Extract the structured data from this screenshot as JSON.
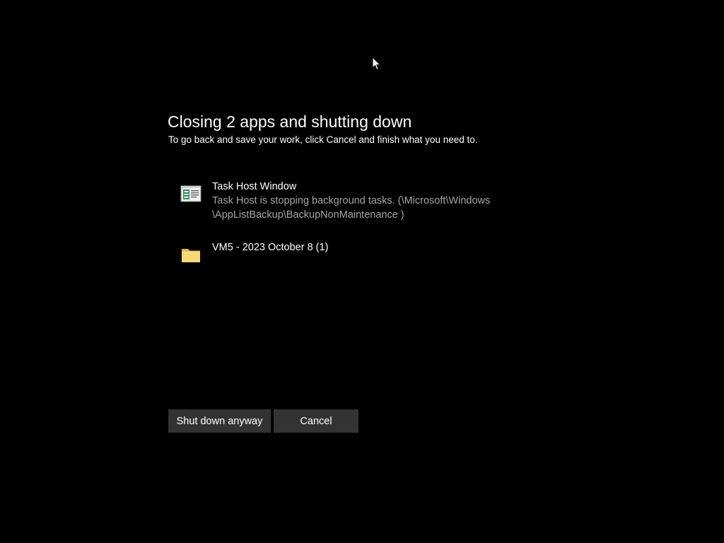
{
  "dialog": {
    "title": "Closing 2 apps and shutting down",
    "subtitle": "To go back and save your work, click Cancel and finish what you need to."
  },
  "apps": [
    {
      "name": "Task Host Window",
      "description_line1": "Task Host is stopping background tasks. (\\Microsoft\\Windows",
      "description_line2": "\\AppListBackup\\BackupNonMaintenance )",
      "icon": "task-host-window-icon"
    },
    {
      "name": "VM5 - 2023 October 8 (1)",
      "icon": "folder-icon"
    }
  ],
  "buttons": {
    "shutdown_label": "Shut down anyway",
    "cancel_label": "Cancel"
  },
  "colors": {
    "background": "#000000",
    "button_bg": "#333333",
    "secondary_text": "#a6a6a6",
    "folder_yellow": "#f8d775"
  }
}
